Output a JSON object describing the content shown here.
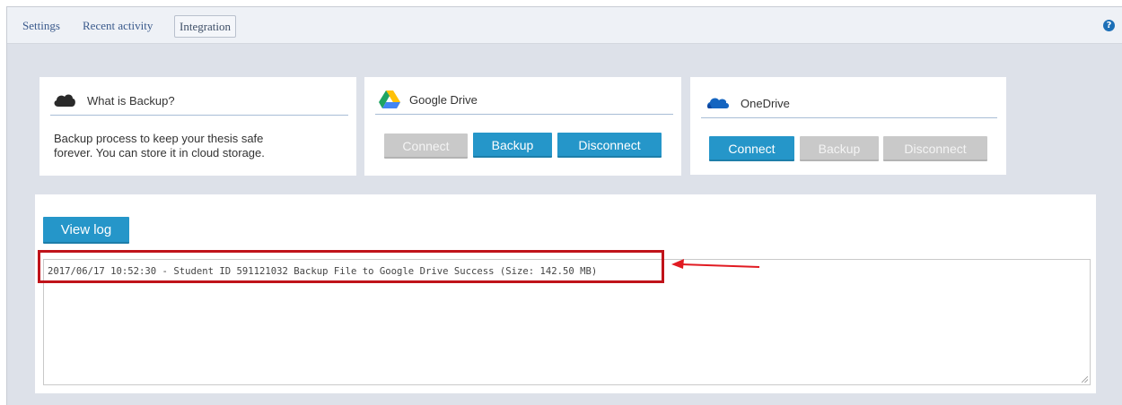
{
  "tabs": [
    {
      "label": "Settings"
    },
    {
      "label": "Recent activity"
    },
    {
      "label": "Integration",
      "active": true
    }
  ],
  "help_icon": "question-circle-icon",
  "backup_card": {
    "icon": "cloud-icon",
    "title": "What is Backup?",
    "text_line1": "Backup process to keep your thesis safe",
    "text_line2": "forever. You can store it in cloud storage."
  },
  "google_drive": {
    "icon": "google-drive-icon",
    "title": "Google Drive",
    "connect_label": "Connect",
    "backup_label": "Backup",
    "disconnect_label": "Disconnect"
  },
  "onedrive": {
    "icon": "onedrive-icon",
    "title": "OneDrive",
    "connect_label": "Connect",
    "backup_label": "Backup",
    "disconnect_label": "Disconnect"
  },
  "log": {
    "view_log_label": "View log",
    "entry": "2017/06/17 10:52:30 - Student ID 591121032 Backup File to Google Drive Success (Size: 142.50 MB)"
  },
  "colors": {
    "accent_blue": "#2596c9",
    "disabled_gray": "#c9c9c9",
    "highlight_red": "#c0131a"
  }
}
